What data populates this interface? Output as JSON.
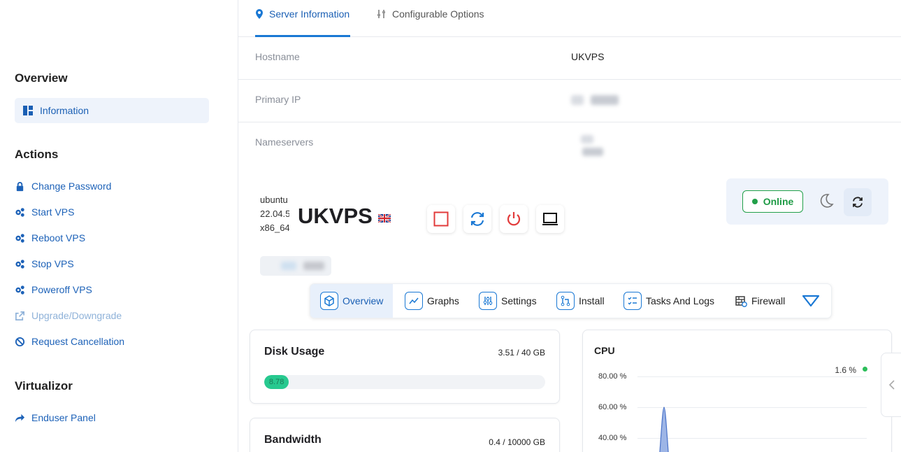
{
  "sidebar": {
    "overview_heading": "Overview",
    "active_item": "Information",
    "actions_heading": "Actions",
    "actions": [
      {
        "label": "Change Password",
        "icon": "lock-icon"
      },
      {
        "label": "Start VPS",
        "icon": "cogs-icon"
      },
      {
        "label": "Reboot VPS",
        "icon": "cogs-icon"
      },
      {
        "label": "Stop VPS",
        "icon": "cogs-icon"
      },
      {
        "label": "Poweroff VPS",
        "icon": "cogs-icon"
      },
      {
        "label": "Upgrade/Downgrade",
        "icon": "external-link-icon"
      },
      {
        "label": "Request Cancellation",
        "icon": "ban-icon"
      }
    ],
    "virtualizor_heading": "Virtualizor",
    "enduser_panel": "Enduser Panel"
  },
  "tabs": {
    "server_info": "Server Information",
    "config_options": "Configurable Options"
  },
  "info": {
    "hostname_label": "Hostname",
    "hostname_value": "UKVPS",
    "primary_ip_label": "Primary IP",
    "nameservers_label": "Nameservers"
  },
  "vps": {
    "os_alt": "ubuntu 22.04.5 x86_64",
    "title": "UKVPS",
    "status": "Online"
  },
  "nav": {
    "items": [
      "Overview",
      "Graphs",
      "Settings",
      "Install",
      "Tasks And Logs",
      "Firewall"
    ]
  },
  "disk": {
    "title": "Disk Usage",
    "value": "3.51 / 40 GB",
    "percent_label": "8.78",
    "percent": 8.78
  },
  "bandwidth": {
    "title": "Bandwidth",
    "value": "0.4 / 10000 GB"
  },
  "cpu": {
    "title": "CPU",
    "current": "1.6 %",
    "ticks": [
      "80.00 %",
      "60.00 %",
      "40.00 %"
    ]
  },
  "colors": {
    "accent": "#1a78d4",
    "online": "#22a04a",
    "progress": "#27c98f",
    "stop": "#e23b3b"
  }
}
